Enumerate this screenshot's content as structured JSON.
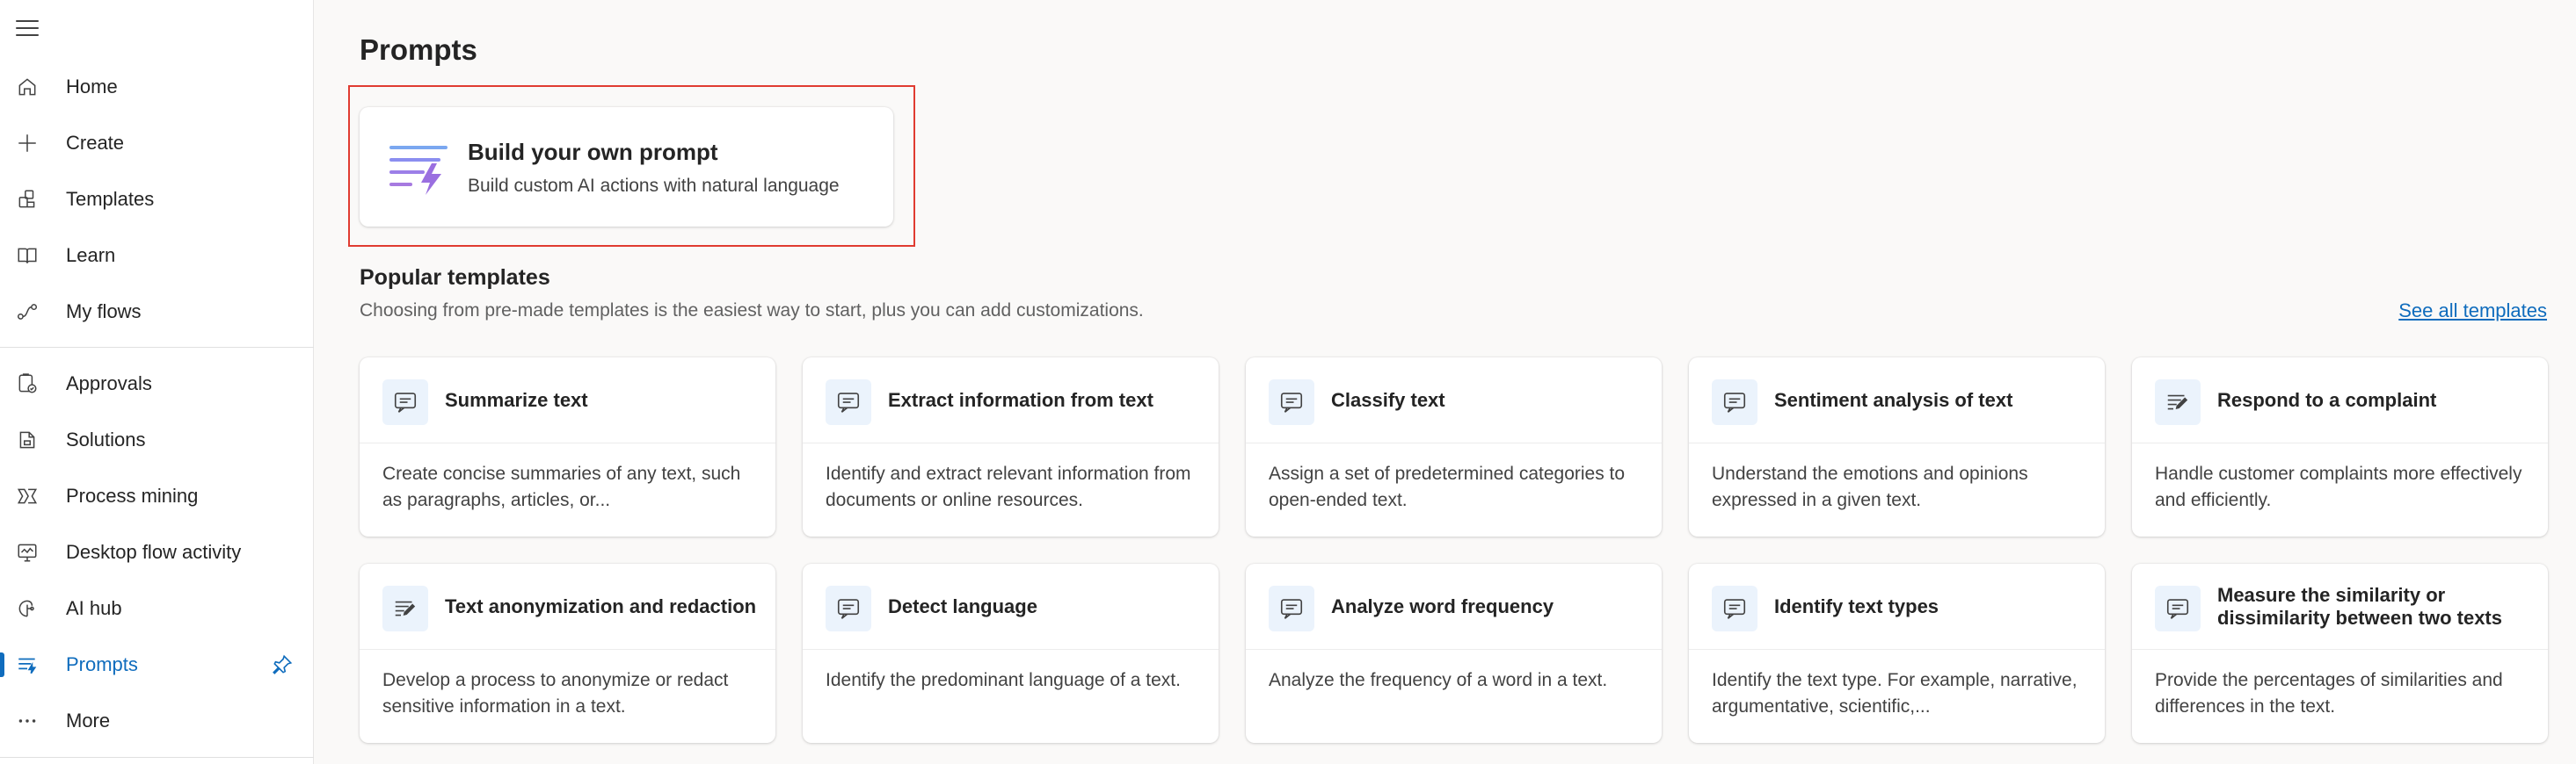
{
  "nav": {
    "items": [
      {
        "label": "Home",
        "icon": "home-icon"
      },
      {
        "label": "Create",
        "icon": "plus-icon"
      },
      {
        "label": "Templates",
        "icon": "templates-icon"
      },
      {
        "label": "Learn",
        "icon": "book-icon"
      },
      {
        "label": "My flows",
        "icon": "flows-icon"
      },
      {
        "label": "Approvals",
        "icon": "approvals-icon"
      },
      {
        "label": "Solutions",
        "icon": "solutions-icon"
      },
      {
        "label": "Process mining",
        "icon": "process-mining-icon"
      },
      {
        "label": "Desktop flow activity",
        "icon": "desktop-flow-icon"
      },
      {
        "label": "AI hub",
        "icon": "ai-hub-icon"
      },
      {
        "label": "Prompts",
        "icon": "prompts-icon",
        "selected": true
      },
      {
        "label": "More",
        "icon": "more-icon"
      }
    ]
  },
  "page": {
    "title": "Prompts"
  },
  "build_card": {
    "title": "Build your own prompt",
    "subtitle": "Build custom AI actions with natural language"
  },
  "popular": {
    "title": "Popular templates",
    "subtitle": "Choosing from pre-made templates is the easiest way to start, plus you can add customizations.",
    "see_all": "See all templates",
    "cards": [
      {
        "title": "Summarize text",
        "desc": "Create concise summaries of any text, such as paragraphs, articles, or...",
        "icon": "chat-doc-icon"
      },
      {
        "title": "Extract information from text",
        "desc": "Identify and extract relevant information from documents or online resources.",
        "icon": "chat-doc-icon"
      },
      {
        "title": "Classify text",
        "desc": "Assign a set of predetermined categories to open-ended text.",
        "icon": "chat-doc-icon"
      },
      {
        "title": "Sentiment analysis of text",
        "desc": "Understand the emotions and opinions expressed in a given text.",
        "icon": "chat-doc-icon"
      },
      {
        "title": "Respond to a complaint",
        "desc": "Handle customer complaints more effectively and efficiently.",
        "icon": "text-edit-icon"
      },
      {
        "title": "Text anonymization and redaction",
        "desc": "Develop a process to anonymize or redact sensitive information in a text.",
        "icon": "text-edit-icon"
      },
      {
        "title": "Detect language",
        "desc": "Identify the predominant language of a text.",
        "icon": "chat-doc-icon"
      },
      {
        "title": "Analyze word frequency",
        "desc": "Analyze the frequency of a word in a text.",
        "icon": "chat-doc-icon"
      },
      {
        "title": "Identify text types",
        "desc": "Identify the text type. For example, narrative, argumentative, scientific,...",
        "icon": "chat-doc-icon"
      },
      {
        "title": "Measure the similarity or dissimilarity between two texts",
        "desc": "Provide the percentages of similarities and differences in the text.",
        "icon": "chat-doc-icon"
      }
    ]
  },
  "colors": {
    "accent": "#0f6cbd",
    "highlight": "#e03c31",
    "icon_bg": "#ebf3fc"
  }
}
